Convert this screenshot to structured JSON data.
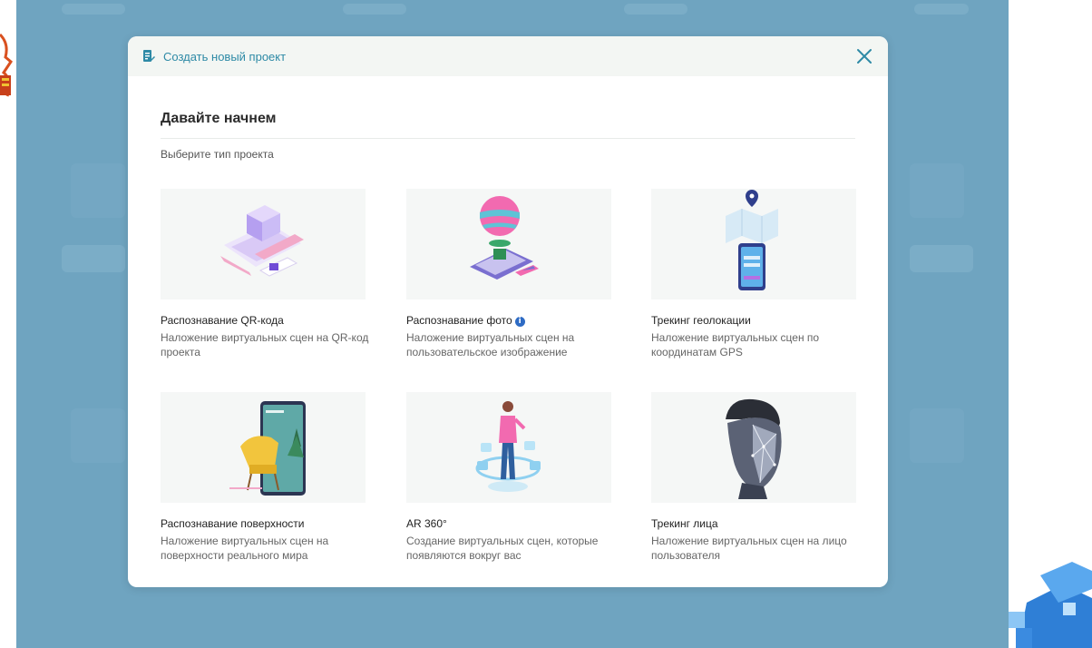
{
  "modal": {
    "title": "Создать новый проект",
    "heading": "Давайте начнем",
    "subheading": "Выберите тип проекта",
    "close_icon": "close-icon",
    "doc_icon": "document-edit-icon"
  },
  "cards": [
    {
      "title": "Распознавание QR-кода",
      "desc": "Наложение виртуальных сцен на QR-код проекта",
      "icon": "qr-recognition-illustration"
    },
    {
      "title": "Распознавание фото",
      "desc": "Наложение виртуальных сцен на пользовательское изображение",
      "icon": "photo-recognition-illustration",
      "has_info": true
    },
    {
      "title": "Трекинг геолокации",
      "desc": "Наложение виртуальных сцен по координатам GPS",
      "icon": "geolocation-illustration"
    },
    {
      "title": "Распознавание поверхности",
      "desc": "Наложение виртуальных сцен на поверхности реального мира",
      "icon": "surface-recognition-illustration"
    },
    {
      "title": "AR 360°",
      "desc": "Создание виртуальных сцен, которые появляются вокруг вас",
      "icon": "ar360-illustration"
    },
    {
      "title": "Трекинг лица",
      "desc": "Наложение виртуальных сцен на лицо пользователя",
      "icon": "face-tracking-illustration"
    }
  ],
  "colors": {
    "accent": "#2e8aa6",
    "backdrop": "#6fa4c0",
    "card_bg": "#f5f7f6"
  }
}
